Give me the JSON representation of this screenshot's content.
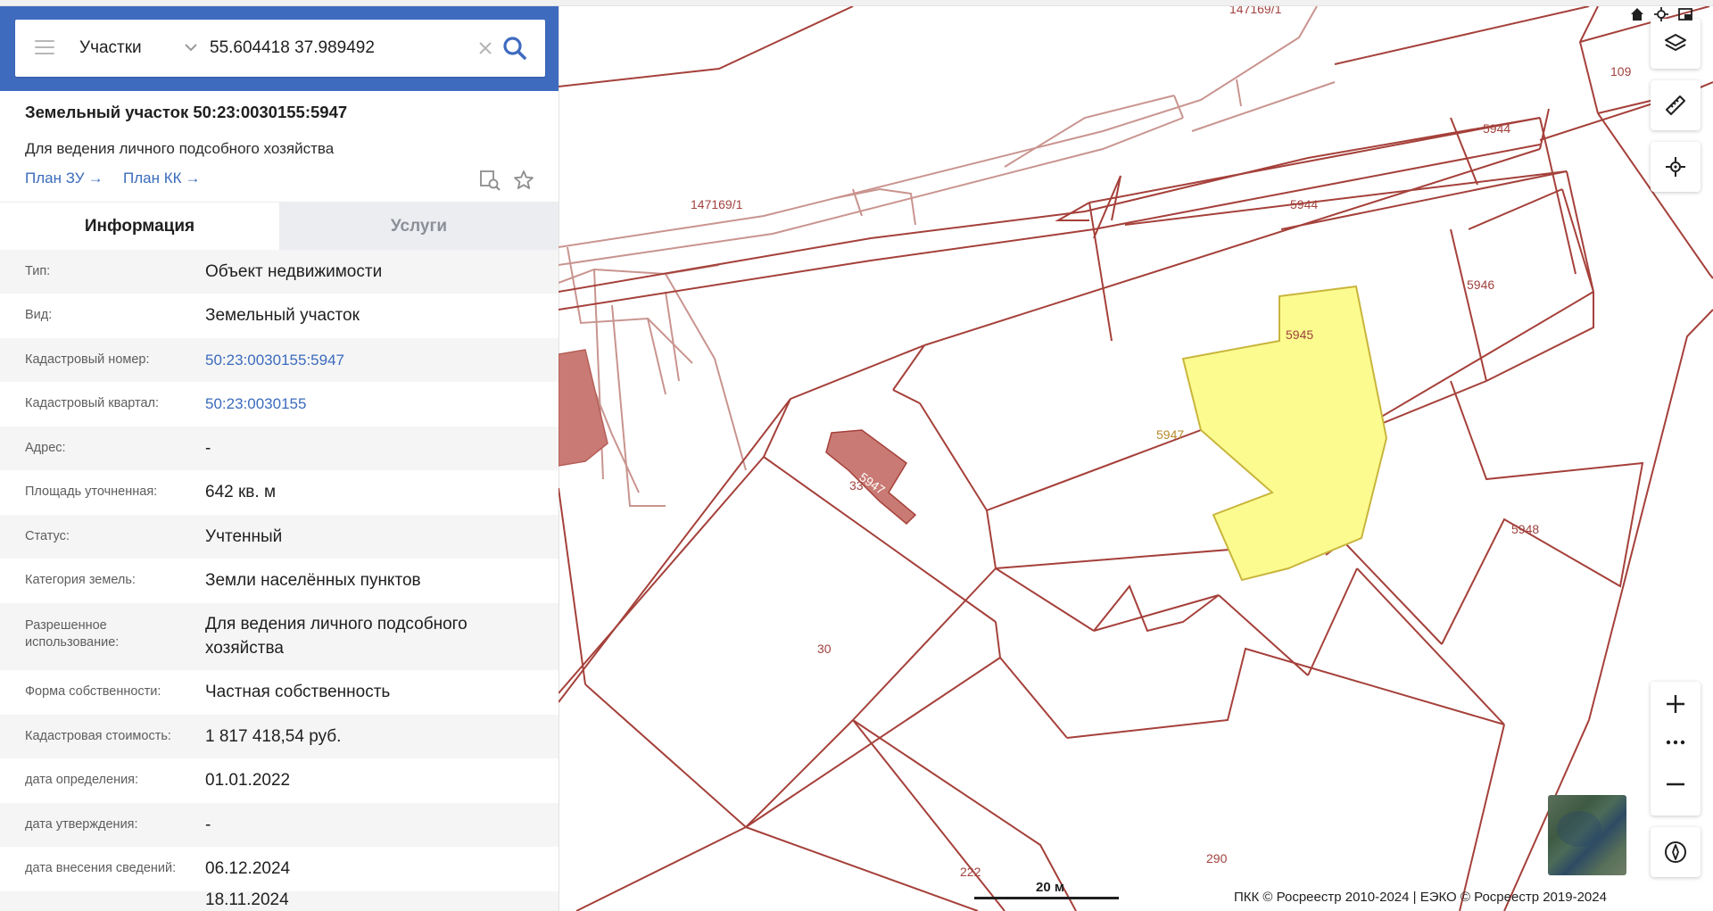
{
  "search": {
    "layer": "Участки",
    "query": "55.604418 37.989492"
  },
  "object": {
    "title": "Земельный участок 50:23:0030155:5947",
    "purpose": "Для ведения личного подсобного хозяйства",
    "plan_zu": "План ЗУ",
    "plan_kk": "План КК"
  },
  "tabs": [
    {
      "label": "Информация",
      "active": true
    },
    {
      "label": "Услуги",
      "active": false
    }
  ],
  "info_rows": [
    {
      "label": "Тип:",
      "value": "Объект недвижимости"
    },
    {
      "label": "Вид:",
      "value": "Земельный участок"
    },
    {
      "label": "Кадастровый номер:",
      "value": "50:23:0030155:5947"
    },
    {
      "label": "Кадастровый квартал:",
      "value": "50:23:0030155"
    },
    {
      "label": "Адрес:",
      "value": "-"
    },
    {
      "label": "Площадь уточненная:",
      "value": "642 кв. м"
    },
    {
      "label": "Статус:",
      "value": "Учтенный"
    },
    {
      "label": "Категория земель:",
      "value": "Земли населённых пунктов"
    },
    {
      "label": "Разрешенное использование:",
      "value": "Для ведения личного подсобного хозяйства"
    },
    {
      "label": "Форма собственности:",
      "value": "Частная собственность"
    },
    {
      "label": "Кадастровая стоимость:",
      "value": "1 817 418,54 руб."
    },
    {
      "label": "дата определения:",
      "value": "01.01.2022"
    },
    {
      "label": "дата утверждения:",
      "value": "-"
    },
    {
      "label": "дата внесения сведений:",
      "value": "06.12.2024"
    },
    {
      "label": "",
      "value": "18.11.2024"
    }
  ],
  "map": {
    "parcel_labels": {
      "p147169_top": "147169/1",
      "p147169_left": "147169/1",
      "p109": "109",
      "p5944a": "5944",
      "p5944b": "5944",
      "p5946": "5946",
      "p5945": "5945",
      "p5947": "5947",
      "p5948": "5948",
      "b5947": "5947",
      "b33": "33",
      "p30": "30",
      "p222": "222",
      "p290": "290"
    },
    "scale_label": "20 м",
    "attribution": "ПКК © Росреестр 2010-2024 | ЕЭКО © Росреестр 2019-2024",
    "colors": {
      "boundary": "#a5403a",
      "selected_fill": "#fbfb8f",
      "selected_stroke": "#c9b53c",
      "building_fill": "#c97a74",
      "accent": "#3f6bbf"
    }
  }
}
